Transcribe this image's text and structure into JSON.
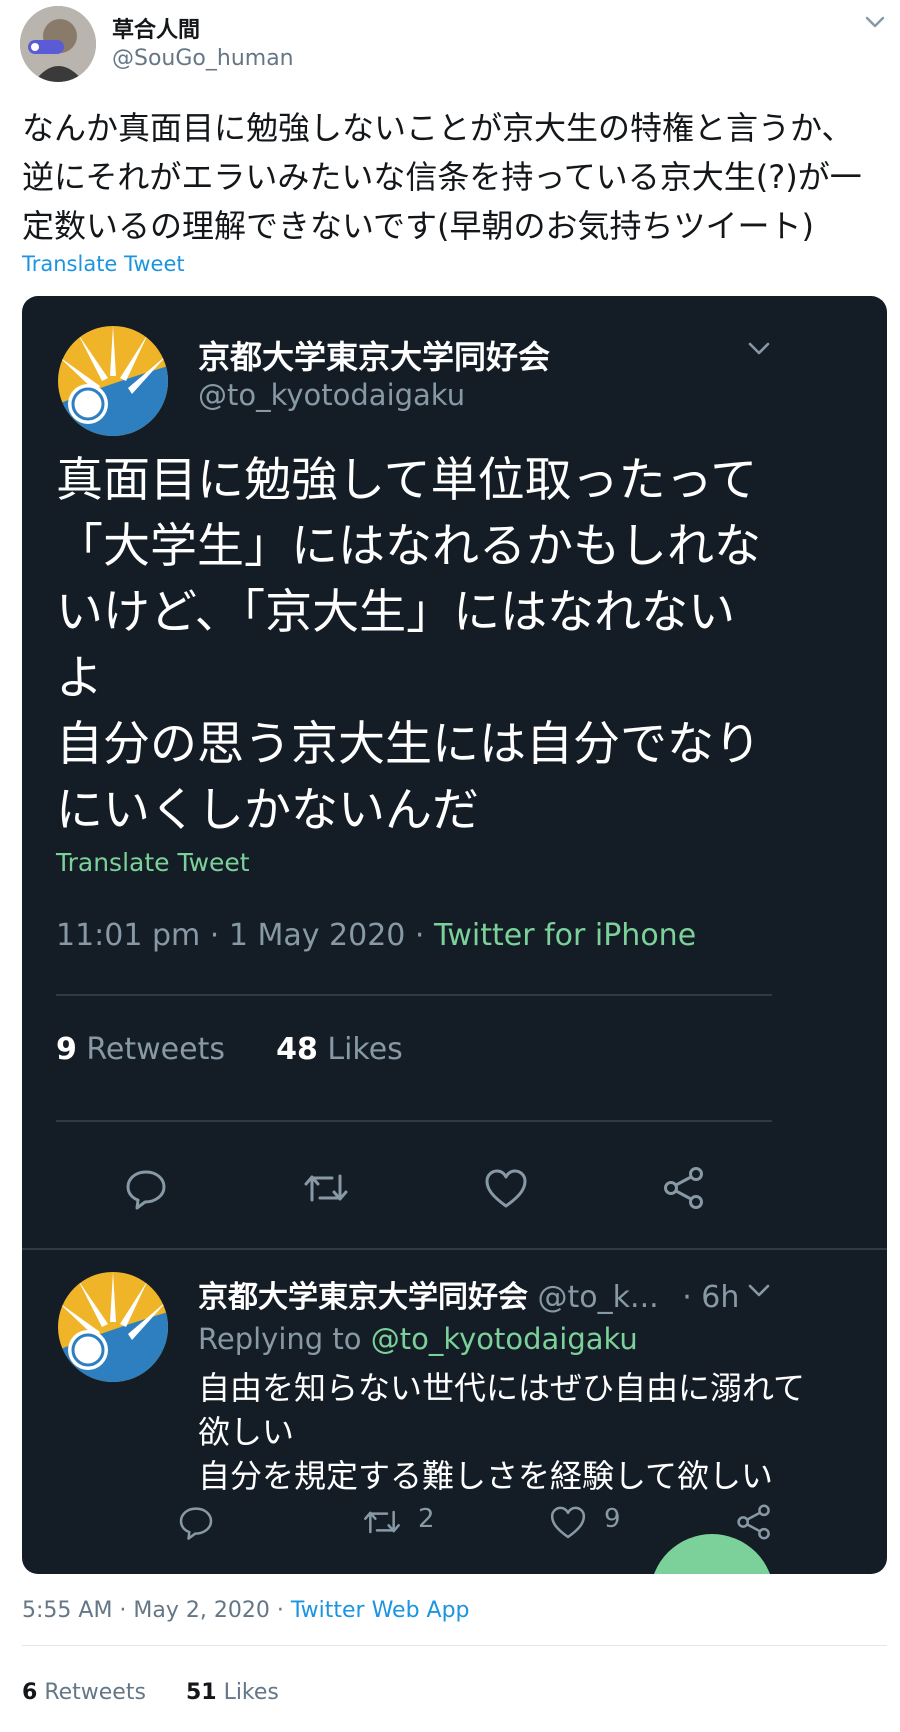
{
  "tweet": {
    "display_name": "草合人間",
    "handle": "@SouGo_human",
    "text": "なんか真面目に勉強しないことが京大生の特権と言うか、\n逆にそれがエラいみたいな信条を持っている京大生(?)が一\n定数いるの理解できないです(早朝のお気持ちツイート)",
    "translate_label": "Translate Tweet",
    "timestamp": "5:55 AM · May 2, 2020 · ",
    "source": "Twitter Web App",
    "retweets_count": "6",
    "retweets_label": "Retweets",
    "likes_count": "51",
    "likes_label": "Likes"
  },
  "quoted": {
    "display_name": "京都大学東京大学同好会",
    "handle": "@to_kyotodaigaku",
    "text": "真面目に勉強して単位取ったって\n「大学生」にはなれるかもしれな\nいけど、「京大生」にはなれない\nよ\n自分の思う京大生には自分でなり\nにいくしかないんだ",
    "translate_label": "Translate Tweet",
    "timestamp": "11:01 pm · 1 May 2020 · ",
    "source": "Twitter for iPhone",
    "retweets_count": "9",
    "retweets_label": "Retweets",
    "likes_count": "48",
    "likes_label": "Likes"
  },
  "reply": {
    "display_name": "京都大学東京大学同好会",
    "handle": "@to_k...",
    "time": "· 6h",
    "replying_prefix": "Replying to ",
    "replying_handle": "@to_kyotodaigaku",
    "text": "自由を知らない世代にはぜひ自由に溺れて\n欲しい\n自分を規定する難しさを経験して欲しい",
    "retweet_count": "2",
    "like_count": "9"
  },
  "colors": {
    "embed_bg": "#141d26",
    "link_blue": "#1b95e0",
    "link_green": "#7bd199",
    "fab_green": "#7bd199"
  },
  "icons": [
    "chevron-down-icon",
    "reply-icon",
    "retweet-icon",
    "like-icon",
    "share-icon"
  ]
}
